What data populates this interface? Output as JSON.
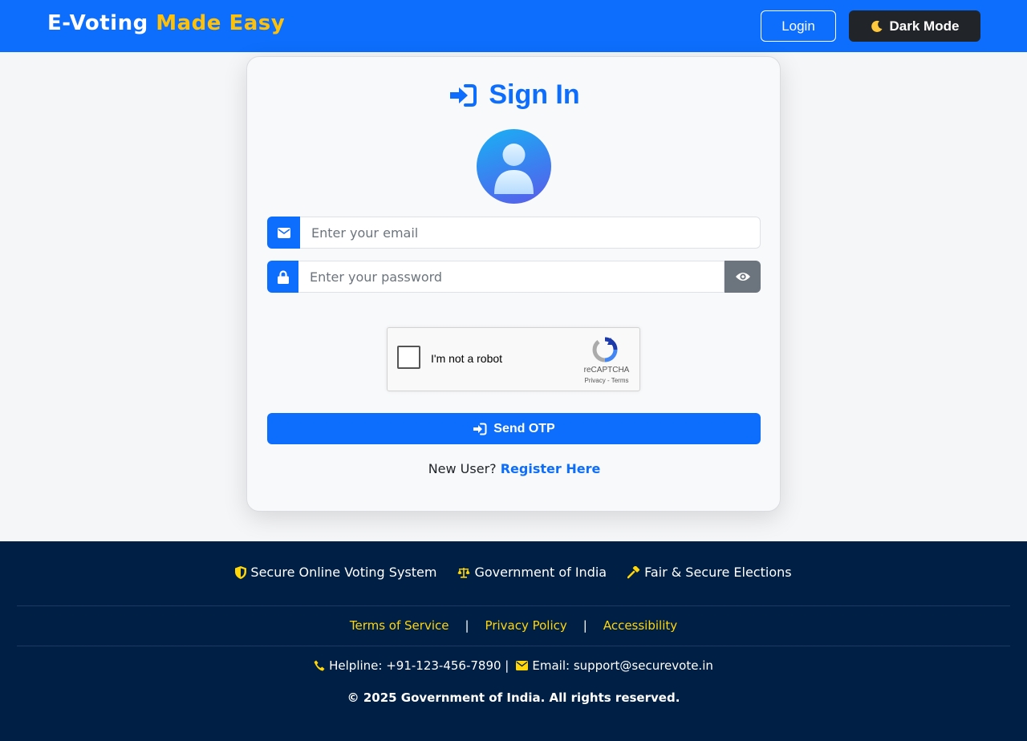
{
  "header": {
    "brand_main": "E-Voting",
    "brand_accent": "Made Easy",
    "login_label": "Login",
    "dark_mode_label": "Dark Mode",
    "colors": {
      "primary": "#0d6efd",
      "accent": "#ffc107",
      "dark": "#212529"
    }
  },
  "signin": {
    "title": "Sign In",
    "email_placeholder": "Enter your email",
    "password_placeholder": "Enter your password",
    "captcha": {
      "label": "I'm not a robot",
      "brand": "reCAPTCHA",
      "links": "Privacy - Terms"
    },
    "send_otp_label": "Send OTP",
    "new_user_text": "New User?",
    "register_label": "Register Here"
  },
  "footer": {
    "badges": [
      {
        "icon": "shield-icon",
        "label": "Secure Online Voting System"
      },
      {
        "icon": "scale-icon",
        "label": "Government of India"
      },
      {
        "icon": "gavel-icon",
        "label": "Fair & Secure Elections"
      }
    ],
    "links": [
      "Terms of Service",
      "Privacy Policy",
      "Accessibility"
    ],
    "separator": "|",
    "helpline": "Helpline: +91-123-456-7890 |",
    "email": "Email: support@securevote.in",
    "copyright": "© 2025 Government of India. All rights reserved.",
    "colors": {
      "background": "#001f45",
      "link": "#ffd60a"
    }
  }
}
